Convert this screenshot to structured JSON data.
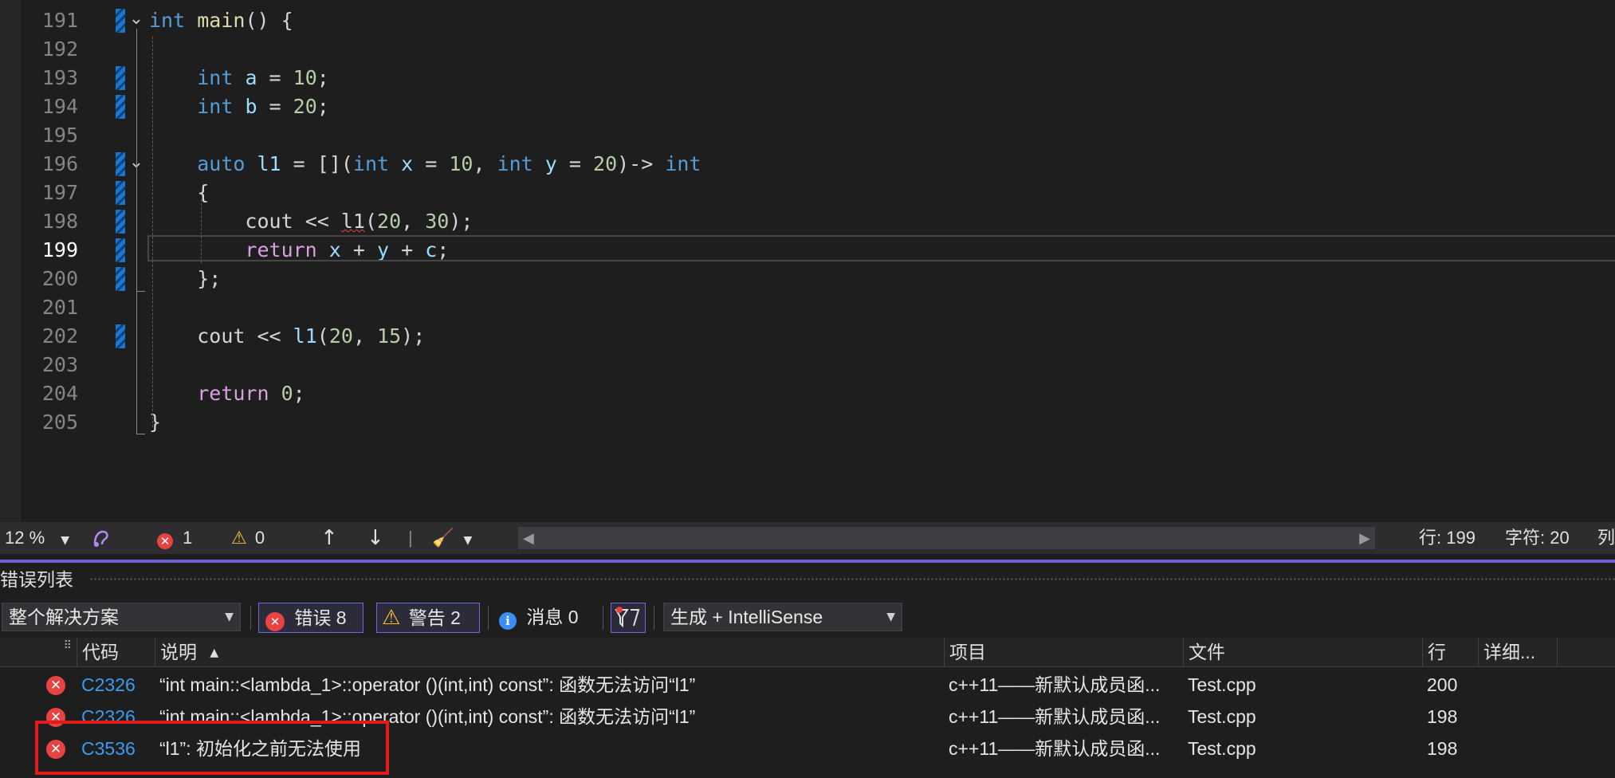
{
  "editor": {
    "lines": [
      {
        "num": "191",
        "tokens": [
          [
            "kw",
            "int"
          ],
          [
            "pl",
            " "
          ],
          [
            "fn",
            "main"
          ],
          [
            "pl",
            "() {"
          ]
        ]
      },
      {
        "num": "192",
        "tokens": []
      },
      {
        "num": "193",
        "tokens": [
          [
            "pl",
            "    "
          ],
          [
            "kw",
            "int"
          ],
          [
            "pl",
            " "
          ],
          [
            "var",
            "a"
          ],
          [
            "pl",
            " = "
          ],
          [
            "num",
            "10"
          ],
          [
            "pl",
            ";"
          ]
        ]
      },
      {
        "num": "194",
        "tokens": [
          [
            "pl",
            "    "
          ],
          [
            "kw",
            "int"
          ],
          [
            "pl",
            " "
          ],
          [
            "var",
            "b"
          ],
          [
            "pl",
            " = "
          ],
          [
            "num",
            "20"
          ],
          [
            "pl",
            ";"
          ]
        ]
      },
      {
        "num": "195",
        "tokens": []
      },
      {
        "num": "196",
        "tokens": [
          [
            "pl",
            "    "
          ],
          [
            "kw",
            "auto"
          ],
          [
            "pl",
            " "
          ],
          [
            "var",
            "l1"
          ],
          [
            "pl",
            " = []("
          ],
          [
            "kw",
            "int"
          ],
          [
            "pl",
            " "
          ],
          [
            "var",
            "x"
          ],
          [
            "pl",
            " = "
          ],
          [
            "num",
            "10"
          ],
          [
            "pl",
            ", "
          ],
          [
            "kw",
            "int"
          ],
          [
            "pl",
            " "
          ],
          [
            "var",
            "y"
          ],
          [
            "pl",
            " = "
          ],
          [
            "num",
            "20"
          ],
          [
            "pl",
            ")-> "
          ],
          [
            "kw",
            "int"
          ]
        ]
      },
      {
        "num": "197",
        "tokens": [
          [
            "pl",
            "    {"
          ]
        ]
      },
      {
        "num": "198",
        "tokens": [
          [
            "pl",
            "        "
          ],
          [
            "pl",
            "cout"
          ],
          [
            "pl",
            " << "
          ],
          [
            "sq",
            "l1"
          ],
          [
            "pl",
            "("
          ],
          [
            "num",
            "20"
          ],
          [
            "pl",
            ", "
          ],
          [
            "num",
            "30"
          ],
          [
            "pl",
            ");"
          ]
        ]
      },
      {
        "num": "199",
        "tokens": [
          [
            "pl",
            "        "
          ],
          [
            "ctl",
            "return"
          ],
          [
            "pl",
            " "
          ],
          [
            "var",
            "x"
          ],
          [
            "pl",
            " + "
          ],
          [
            "var",
            "y"
          ],
          [
            "pl",
            " + "
          ],
          [
            "var",
            "c"
          ],
          [
            "pl",
            ";"
          ]
        ]
      },
      {
        "num": "200",
        "tokens": [
          [
            "pl",
            "    };"
          ]
        ]
      },
      {
        "num": "201",
        "tokens": []
      },
      {
        "num": "202",
        "tokens": [
          [
            "pl",
            "    "
          ],
          [
            "pl",
            "cout"
          ],
          [
            "pl",
            " << "
          ],
          [
            "var",
            "l1"
          ],
          [
            "pl",
            "("
          ],
          [
            "num",
            "20"
          ],
          [
            "pl",
            ", "
          ],
          [
            "num",
            "15"
          ],
          [
            "pl",
            ");"
          ]
        ]
      },
      {
        "num": "203",
        "tokens": []
      },
      {
        "num": "204",
        "tokens": [
          [
            "pl",
            "    "
          ],
          [
            "ctl",
            "return"
          ],
          [
            "pl",
            " "
          ],
          [
            "num",
            "0"
          ],
          [
            "pl",
            ";"
          ]
        ]
      },
      {
        "num": "205",
        "tokens": [
          [
            "pl",
            "}"
          ]
        ]
      }
    ],
    "changed_lines": [
      "191",
      "193",
      "194",
      "196",
      "197",
      "198",
      "199",
      "200",
      "202"
    ],
    "fold_lines": [
      "191",
      "196"
    ],
    "current_line": "199"
  },
  "status": {
    "zoom": "12 %",
    "errors": "1",
    "warnings": "0",
    "line": "行: 199",
    "char": "字符: 20",
    "col": "列"
  },
  "error_list": {
    "title": "错误列表",
    "scope": "整个解决方案",
    "errors_btn": "错误 8",
    "warnings_btn": "警告 2",
    "messages_btn": "消息 0",
    "source": "生成 + IntelliSense",
    "columns": {
      "code": "代码",
      "desc": "说明",
      "project": "项目",
      "file": "文件",
      "line": "行",
      "detail": "详细..."
    },
    "rows": [
      {
        "code": "C2326",
        "desc": "“int main::<lambda_1>::operator ()(int,int) const”: 函数无法访问“l1”",
        "project": "c++11——新默认成员函...",
        "file": "Test.cpp",
        "line": "200"
      },
      {
        "code": "C2326",
        "desc": "“int main::<lambda_1>::operator ()(int,int) const”: 函数无法访问“l1”",
        "project": "c++11——新默认成员函...",
        "file": "Test.cpp",
        "line": "198"
      },
      {
        "code": "C3536",
        "desc": "“l1”: 初始化之前无法使用",
        "project": "c++11——新默认成员函...",
        "file": "Test.cpp",
        "line": "198"
      }
    ]
  },
  "colors": {
    "accent": "#6b5fd3",
    "error": "#e84242",
    "highlight": "#e01b1b"
  }
}
